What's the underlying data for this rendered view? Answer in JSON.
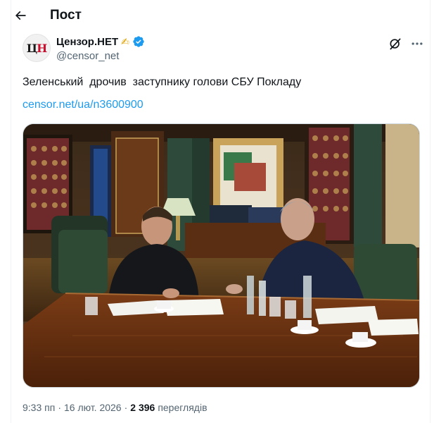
{
  "header": {
    "title": "Пост"
  },
  "author": {
    "avatar_text_1": "Ц",
    "avatar_text_2": "Н",
    "display_name": "Цензор.НЕТ",
    "name_emoji": "✍",
    "handle": "@censor_net"
  },
  "post": {
    "text": "Зеленський  дрочив  заступнику голови СБУ Покладу",
    "link": "censor.net/ua/n3600900"
  },
  "meta": {
    "time": "9:33 пп",
    "separator": "·",
    "date": "16 лют. 2026",
    "views_count": "2 396",
    "views_label": "переглядів"
  },
  "colors": {
    "accent": "#1d9bf0",
    "text_primary": "#0f1419",
    "text_secondary": "#536471",
    "border": "#eff3f4"
  },
  "icons": {
    "back": "arrow-left-icon",
    "verified": "verified-badge-icon",
    "grok": "grok-icon",
    "more": "more-icon"
  }
}
